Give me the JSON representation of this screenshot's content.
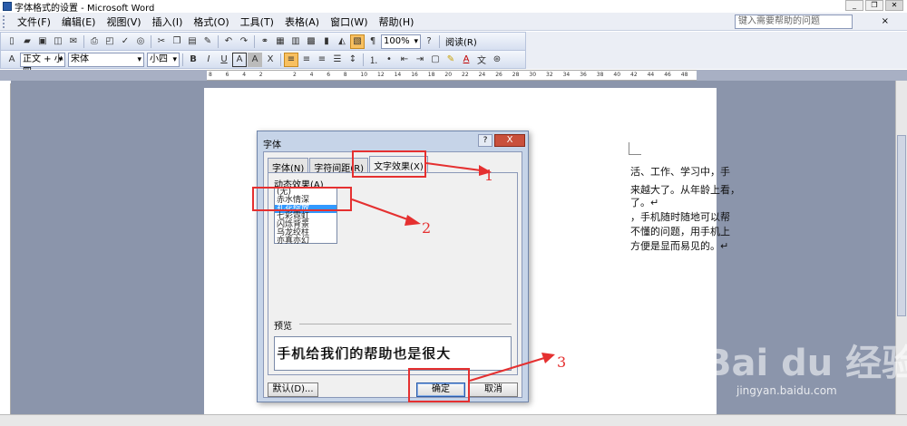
{
  "window": {
    "title": "字体格式的设置 - Microsoft Word",
    "minimize": "_",
    "restore": "❐",
    "close": "✕"
  },
  "menubar": {
    "items": [
      "文件(F)",
      "编辑(E)",
      "视图(V)",
      "插入(I)",
      "格式(O)",
      "工具(T)",
      "表格(A)",
      "窗口(W)",
      "帮助(H)"
    ],
    "help_placeholder": "键入需要帮助的问题",
    "close": "×"
  },
  "toolbar1": {
    "zoom": "100%",
    "read_label": "阅读(R)"
  },
  "toolbar2": {
    "style": "正文 + 小四",
    "font": "宋体",
    "size": "小四",
    "bold": "B",
    "italic": "I",
    "underline": "U",
    "char_border": "A",
    "char_shade": "A",
    "a_z": "X",
    "font_color": "A",
    "wen": "文"
  },
  "ruler": {
    "ticks": [
      "8",
      "6",
      "4",
      "2",
      "",
      "2",
      "4",
      "6",
      "8",
      "10",
      "12",
      "14",
      "16",
      "18",
      "20",
      "22",
      "24",
      "26",
      "28",
      "30",
      "32",
      "34",
      "36",
      "38",
      "40",
      "42",
      "44",
      "46",
      "48"
    ]
  },
  "document": {
    "lines": [
      "活、工作、学习中，手",
      "来越大了。从年龄上看，",
      "了。↵",
      "，手机随时随地可以帮",
      "不懂的问题，用手机上",
      "方便是显而易见的。↵"
    ]
  },
  "dialog": {
    "title": "字体",
    "help": "?",
    "close": "X",
    "tabs": [
      "字体(N)",
      "字符间距(R)",
      "文字效果(X)"
    ],
    "active_tab": "文字效果(X)",
    "effects_label": "动态效果(A)",
    "effects": [
      "(无)",
      "赤水情深",
      "礼花绽放",
      "七彩霓虹",
      "闪烁背景",
      "乌龙绞柱",
      "亦真亦幻"
    ],
    "selected_effect": "礼花绽放",
    "preview_label": "预览",
    "preview_text": "手机给我们的帮助也是很大",
    "default_button": "默认(D)...",
    "ok_button": "确定",
    "cancel_button": "取消"
  },
  "annotations": {
    "marker_1": "1",
    "marker_2": "2",
    "marker_3": "3",
    "color": "#e53030"
  },
  "watermark": {
    "logo": "Bai du 经验",
    "url": "jingyan.baidu.com"
  }
}
